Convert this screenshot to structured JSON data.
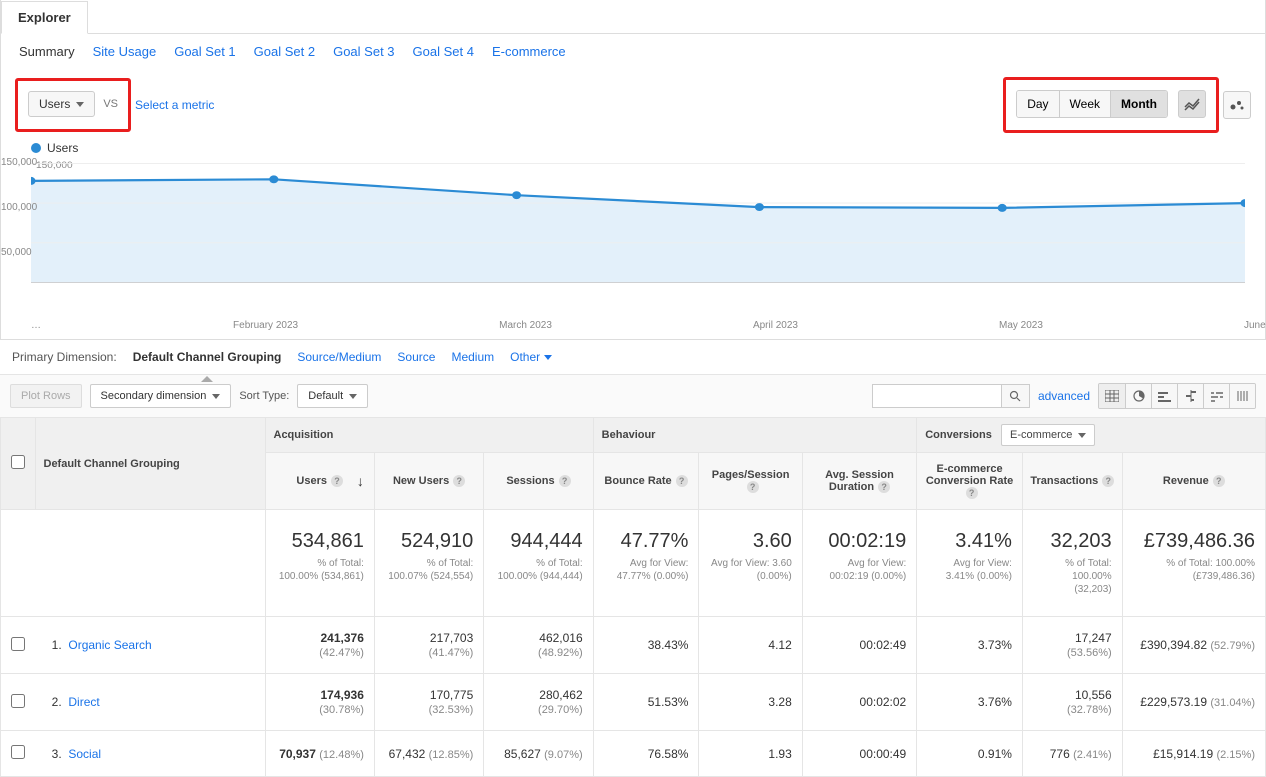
{
  "tabs": {
    "explorer": "Explorer"
  },
  "subnav": [
    "Summary",
    "Site Usage",
    "Goal Set 1",
    "Goal Set 2",
    "Goal Set 3",
    "Goal Set 4",
    "E-commerce"
  ],
  "metric_selector": {
    "label": "Users",
    "vs": "VS",
    "select_metric": "Select a metric"
  },
  "granularity": {
    "day": "Day",
    "week": "Week",
    "month": "Month"
  },
  "chart_legend": "Users",
  "chart_data": {
    "type": "line",
    "title": "",
    "xlabel": "",
    "ylabel": "",
    "ylim": [
      0,
      150000
    ],
    "yticks": [
      "50,000",
      "100,000",
      "150,000"
    ],
    "categories": [
      "…",
      "February 2023",
      "March 2023",
      "April 2023",
      "May 2023",
      "June…"
    ],
    "series": [
      {
        "name": "Users",
        "color": "#2b8bd4",
        "values": [
          128000,
          130000,
          110000,
          95000,
          94000,
          100000
        ]
      }
    ]
  },
  "primary_dimension": {
    "label": "Primary Dimension:",
    "active": "Default Channel Grouping",
    "options": [
      "Source/Medium",
      "Source",
      "Medium",
      "Other"
    ]
  },
  "table_controls": {
    "plot_rows": "Plot Rows",
    "secondary_dimension": "Secondary dimension",
    "sort_type_label": "Sort Type:",
    "sort_default": "Default",
    "advanced": "advanced"
  },
  "table": {
    "dimension_header": "Default Channel Grouping",
    "groups": {
      "acquisition": "Acquisition",
      "behaviour": "Behaviour",
      "conversions": "Conversions",
      "ecommerce": "E-commerce"
    },
    "metric_headers": {
      "users": "Users",
      "new_users": "New Users",
      "sessions": "Sessions",
      "bounce_rate": "Bounce Rate",
      "pages_session": "Pages/Session",
      "avg_duration": "Avg. Session Duration",
      "conv_rate": "E-commerce Conversion Rate",
      "transactions": "Transactions",
      "revenue": "Revenue"
    },
    "totals": {
      "users": {
        "big": "534,861",
        "small": "% of Total: 100.00% (534,861)"
      },
      "new_users": {
        "big": "524,910",
        "small": "% of Total: 100.07% (524,554)"
      },
      "sessions": {
        "big": "944,444",
        "small": "% of Total: 100.00% (944,444)"
      },
      "bounce_rate": {
        "big": "47.77%",
        "small": "Avg for View: 47.77% (0.00%)"
      },
      "pages_session": {
        "big": "3.60",
        "small": "Avg for View: 3.60 (0.00%)"
      },
      "avg_duration": {
        "big": "00:02:19",
        "small": "Avg for View: 00:02:19 (0.00%)"
      },
      "conv_rate": {
        "big": "3.41%",
        "small": "Avg for View: 3.41% (0.00%)"
      },
      "transactions": {
        "big": "32,203",
        "small": "% of Total: 100.00% (32,203)"
      },
      "revenue": {
        "big": "£739,486.36",
        "small": "% of Total: 100.00% (£739,486.36)"
      }
    },
    "rows": [
      {
        "n": "1.",
        "name": "Organic Search",
        "users": "241,376",
        "users_pct": "(42.47%)",
        "new_users": "217,703",
        "new_users_pct": "(41.47%)",
        "sessions": "462,016",
        "sessions_pct": "(48.92%)",
        "bounce": "38.43%",
        "pages": "4.12",
        "duration": "00:02:49",
        "conv": "3.73%",
        "trans": "17,247",
        "trans_pct": "(53.56%)",
        "rev": "£390,394.82",
        "rev_pct": "(52.79%)"
      },
      {
        "n": "2.",
        "name": "Direct",
        "users": "174,936",
        "users_pct": "(30.78%)",
        "new_users": "170,775",
        "new_users_pct": "(32.53%)",
        "sessions": "280,462",
        "sessions_pct": "(29.70%)",
        "bounce": "51.53%",
        "pages": "3.28",
        "duration": "00:02:02",
        "conv": "3.76%",
        "trans": "10,556",
        "trans_pct": "(32.78%)",
        "rev": "£229,573.19",
        "rev_pct": "(31.04%)"
      },
      {
        "n": "3.",
        "name": "Social",
        "users": "70,937",
        "users_pct": "(12.48%)",
        "new_users": "67,432",
        "new_users_pct": "(12.85%)",
        "sessions": "85,627",
        "sessions_pct": "(9.07%)",
        "bounce": "76.58%",
        "pages": "1.93",
        "duration": "00:00:49",
        "conv": "0.91%",
        "trans": "776",
        "trans_pct": "(2.41%)",
        "rev": "£15,914.19",
        "rev_pct": "(2.15%)"
      }
    ]
  }
}
